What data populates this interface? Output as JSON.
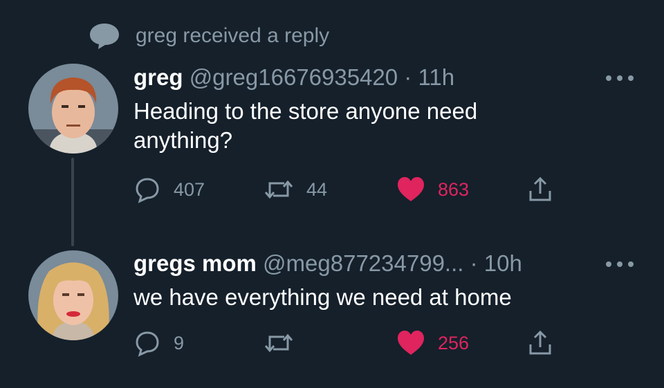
{
  "notification": {
    "icon": "reply-bubble-icon",
    "text": "greg received a reply"
  },
  "tweets": [
    {
      "name": "greg",
      "handle": "@greg16676935420",
      "time": "· 11h",
      "text": "Heading to the store anyone need anything?",
      "replies": "407",
      "retweets": "44",
      "likes": "863",
      "liked": true,
      "avatar": "avatar-greg"
    },
    {
      "name": "gregs mom",
      "handle": "@meg877234799...",
      "time": "· 10h",
      "text": "we have everything we need at home",
      "replies": "9",
      "retweets": "",
      "likes": "256",
      "liked": true,
      "avatar": "avatar-gregs-mom"
    }
  ],
  "colors": {
    "background": "#15202b",
    "secondary_text": "#8899a6",
    "like": "#e0245e",
    "thread_line": "#38444d"
  }
}
